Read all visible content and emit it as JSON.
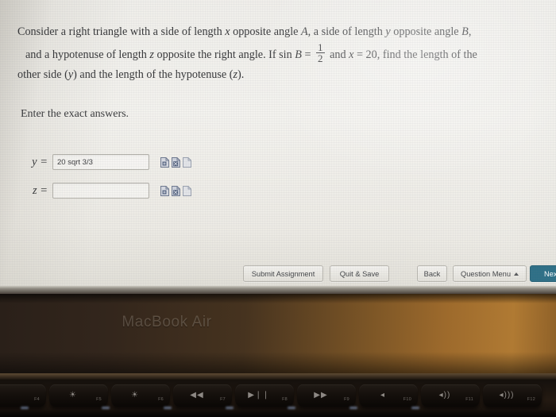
{
  "problem": {
    "line1_a": "Consider a right triangle with a side of length",
    "line1_var1": "x",
    "line1_b": "opposite angle",
    "line1_var2": "A",
    "line1_c": ", a side of length",
    "line1_var3": "y",
    "line1_d": "opposite angle",
    "line1_var4": "B",
    "line1_e": ",",
    "line2_a": "and a hypotenuse of length",
    "line2_var1": "z",
    "line2_b": "opposite the right angle. If sin",
    "line2_var2": "B",
    "line2_eq": "=",
    "line2_frac_num": "1",
    "line2_frac_den": "2",
    "line2_c": "and",
    "line2_var3": "x",
    "line2_eq2": "= 20",
    "line2_d": ", find the length of the",
    "line3_a": "other side (",
    "line3_var1": "y",
    "line3_b": ") and the length of the hypotenuse (",
    "line3_var2": "z",
    "line3_c": ")."
  },
  "instruction": "Enter the exact answers.",
  "answers": [
    {
      "label": "y =",
      "value": "20 sqrt 3/3",
      "placeholder": "",
      "icons": [
        "document-preview-icon",
        "document-math-icon",
        "document-blank-icon"
      ]
    },
    {
      "label": "z =",
      "value": "",
      "placeholder": "",
      "icons": [
        "document-preview-icon",
        "document-math-icon",
        "document-blank-icon"
      ]
    }
  ],
  "buttons": {
    "submit": "Submit Assignment",
    "quit": "Quit & Save",
    "back": "Back",
    "question_menu": "Question Menu",
    "next": "Next"
  },
  "colors": {
    "next_button": "#2e7087",
    "button_text": "#45474a",
    "screen_text": "#37383a",
    "bezel_brown": "#7b5526"
  },
  "laptop": {
    "brand_label": "MacBook Air",
    "function_keys": [
      {
        "glyph": "",
        "fnum": "F4",
        "name": "fkey-f4"
      },
      {
        "glyph": "☀",
        "fnum": "F5",
        "name": "fkey-f5-keyboard-brightness-down"
      },
      {
        "glyph": "☀",
        "fnum": "F6",
        "name": "fkey-f6-keyboard-brightness-up"
      },
      {
        "glyph": "◀◀",
        "fnum": "F7",
        "name": "fkey-f7-rewind"
      },
      {
        "glyph": "▶❘❘",
        "fnum": "F8",
        "name": "fkey-f8-play-pause"
      },
      {
        "glyph": "▶▶",
        "fnum": "F9",
        "name": "fkey-f9-fast-forward"
      },
      {
        "glyph": "◂",
        "fnum": "F10",
        "name": "fkey-f10-mute"
      },
      {
        "glyph": "◂))",
        "fnum": "F11",
        "name": "fkey-f11-volume-down"
      },
      {
        "glyph": "◂)))",
        "fnum": "F12",
        "name": "fkey-f12-volume-up"
      }
    ]
  }
}
